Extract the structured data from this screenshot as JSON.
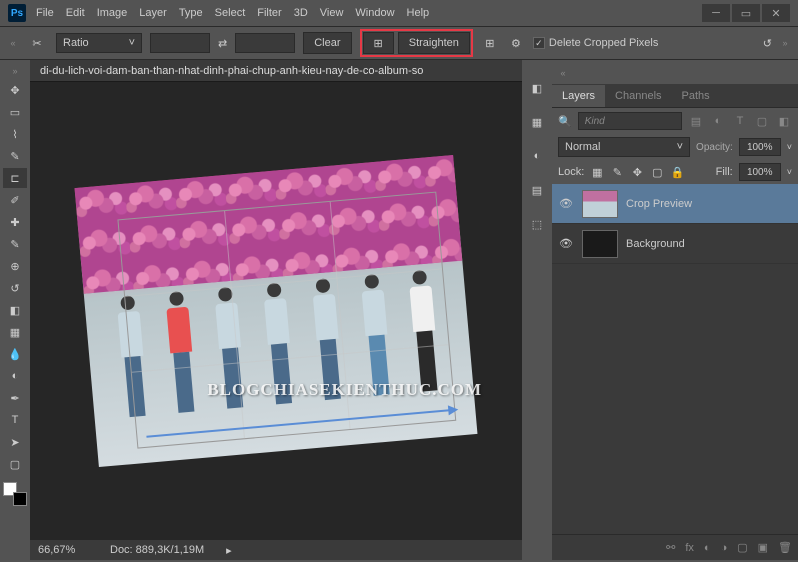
{
  "app": {
    "logo": "Ps"
  },
  "menu": [
    "File",
    "Edit",
    "Image",
    "Layer",
    "Type",
    "Select",
    "Filter",
    "3D",
    "View",
    "Window",
    "Help"
  ],
  "options": {
    "ratio_label": "Ratio",
    "clear": "Clear",
    "straighten": "Straighten",
    "delete_cropped": "Delete Cropped Pixels"
  },
  "doc": {
    "tab": "di-du-lich-voi-dam-ban-than-nhat-dinh-phai-chup-anh-kieu-nay-de-co-album-so",
    "zoom": "66,67%",
    "status": "Doc: 889,3K/1,19M"
  },
  "watermark": "BLOGCHIASEKIENTHUC.COM",
  "panels": {
    "tabs": [
      "Layers",
      "Channels",
      "Paths"
    ],
    "kind_placeholder": "Kind",
    "blend_mode": "Normal",
    "opacity_label": "Opacity:",
    "opacity_value": "100%",
    "lock_label": "Lock:",
    "fill_label": "Fill:",
    "fill_value": "100%",
    "layers": [
      {
        "name": "Crop Preview",
        "visible": true,
        "selected": true
      },
      {
        "name": "Background",
        "visible": true,
        "selected": false
      }
    ]
  }
}
